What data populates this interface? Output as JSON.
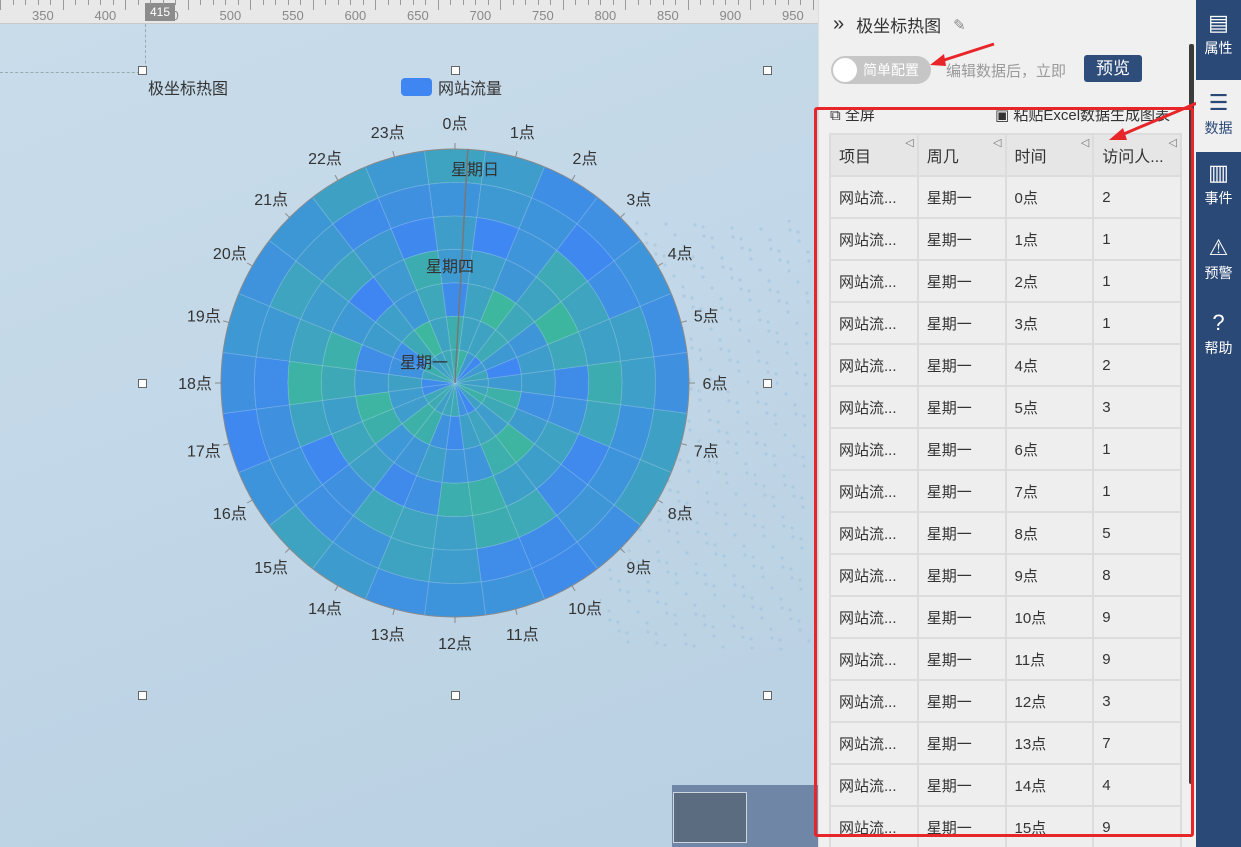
{
  "ruler": {
    "labels": [
      "350",
      "400",
      "450",
      "500",
      "550",
      "600",
      "650",
      "700",
      "750",
      "800",
      "850",
      "900",
      "950"
    ],
    "marker": "415"
  },
  "chart_data": {
    "type": "heatmap",
    "title": "极坐标热图",
    "legend": [
      "网站流量"
    ],
    "angle_labels": [
      "0点",
      "1点",
      "2点",
      "3点",
      "4点",
      "5点",
      "6点",
      "7点",
      "8点",
      "9点",
      "10点",
      "11点",
      "12点",
      "13点",
      "14点",
      "15点",
      "16点",
      "17点",
      "18点",
      "19点",
      "20点",
      "21点",
      "22点",
      "23点"
    ],
    "radial_labels": [
      "星期一",
      "星期四",
      "星期日"
    ],
    "series_color": "#3f86f3",
    "color_range": [
      "#3f86f3",
      "#3db89c"
    ]
  },
  "panel": {
    "title": "极坐标热图",
    "toggle_label": "简单配置",
    "hint": "编辑数据后，立即",
    "preview": "预览",
    "fullscreen": "全屏",
    "paste": "粘贴Excel数据生成图表"
  },
  "table": {
    "headers": [
      "项目",
      "周几",
      "时间",
      "访问人..."
    ],
    "rows": [
      [
        "网站流...",
        "星期一",
        "0点",
        "2"
      ],
      [
        "网站流...",
        "星期一",
        "1点",
        "1"
      ],
      [
        "网站流...",
        "星期一",
        "2点",
        "1"
      ],
      [
        "网站流...",
        "星期一",
        "3点",
        "1"
      ],
      [
        "网站流...",
        "星期一",
        "4点",
        "2"
      ],
      [
        "网站流...",
        "星期一",
        "5点",
        "3"
      ],
      [
        "网站流...",
        "星期一",
        "6点",
        "1"
      ],
      [
        "网站流...",
        "星期一",
        "7点",
        "1"
      ],
      [
        "网站流...",
        "星期一",
        "8点",
        "5"
      ],
      [
        "网站流...",
        "星期一",
        "9点",
        "8"
      ],
      [
        "网站流...",
        "星期一",
        "10点",
        "9"
      ],
      [
        "网站流...",
        "星期一",
        "11点",
        "9"
      ],
      [
        "网站流...",
        "星期一",
        "12点",
        "3"
      ],
      [
        "网站流...",
        "星期一",
        "13点",
        "7"
      ],
      [
        "网站流...",
        "星期一",
        "14点",
        "4"
      ],
      [
        "网站流...",
        "星期一",
        "15点",
        "9"
      ]
    ]
  },
  "sidenav": [
    {
      "label": "属性",
      "icon": "properties-icon"
    },
    {
      "label": "数据",
      "icon": "database-icon"
    },
    {
      "label": "事件",
      "icon": "event-icon"
    },
    {
      "label": "预警",
      "icon": "alarm-icon"
    },
    {
      "label": "帮助",
      "icon": "help-icon"
    }
  ]
}
